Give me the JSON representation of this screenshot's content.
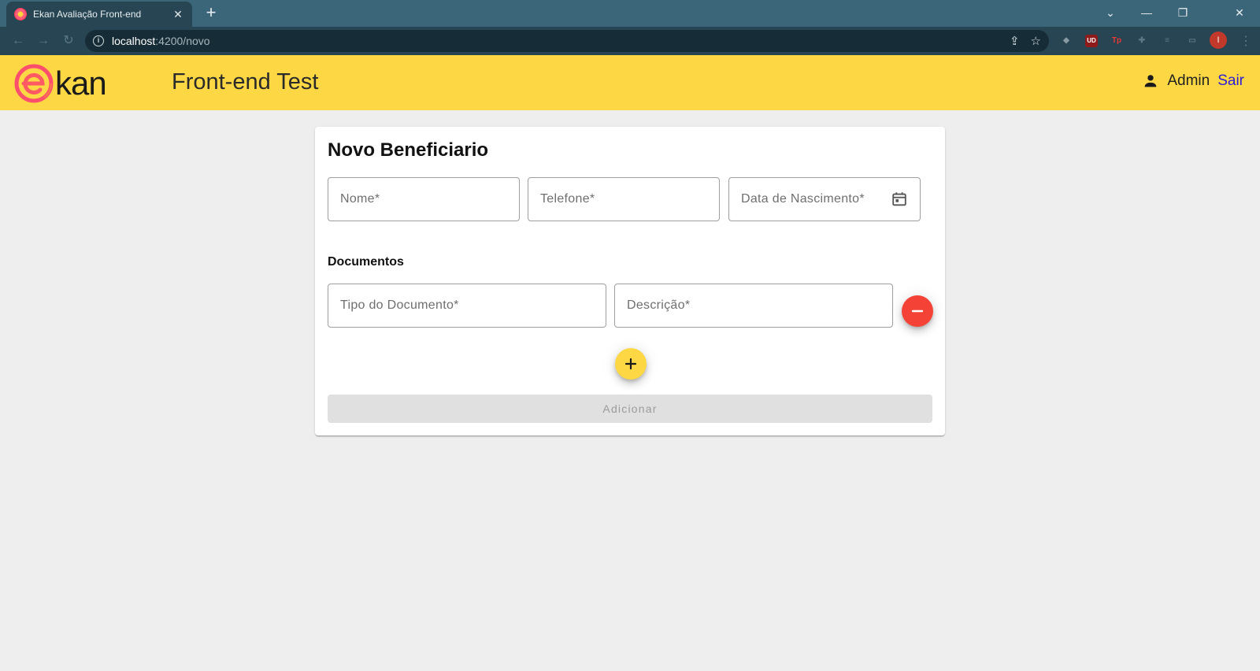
{
  "browser": {
    "tab_title": "Ekan Avaliação Front-end",
    "tab_close": "✕",
    "new_tab": "+",
    "url_host": "localhost",
    "url_path": ":4200/novo",
    "window_controls": [
      "⌄",
      "—",
      "❐",
      "✕"
    ],
    "extensions": [
      "UD",
      "Tp"
    ],
    "profile_initial": "I"
  },
  "header": {
    "logo_text": "kan",
    "title": "Front-end Test",
    "user_name": "Admin",
    "logout_label": "Sair",
    "brand_color": "#fdd844"
  },
  "form": {
    "title": "Novo Beneficiario",
    "fields": {
      "nome": {
        "placeholder": "Nome*",
        "value": ""
      },
      "telefone": {
        "placeholder": "Telefone*",
        "value": ""
      },
      "nascimento": {
        "placeholder": "Data de Nascimento*",
        "value": ""
      }
    },
    "documents_label": "Documentos",
    "documents": [
      {
        "tipo_placeholder": "Tipo do Documento*",
        "descricao_placeholder": "Descrição*"
      }
    ],
    "remove_color": "#f44336",
    "submit_label": "Adicionar",
    "submit_disabled": true
  }
}
